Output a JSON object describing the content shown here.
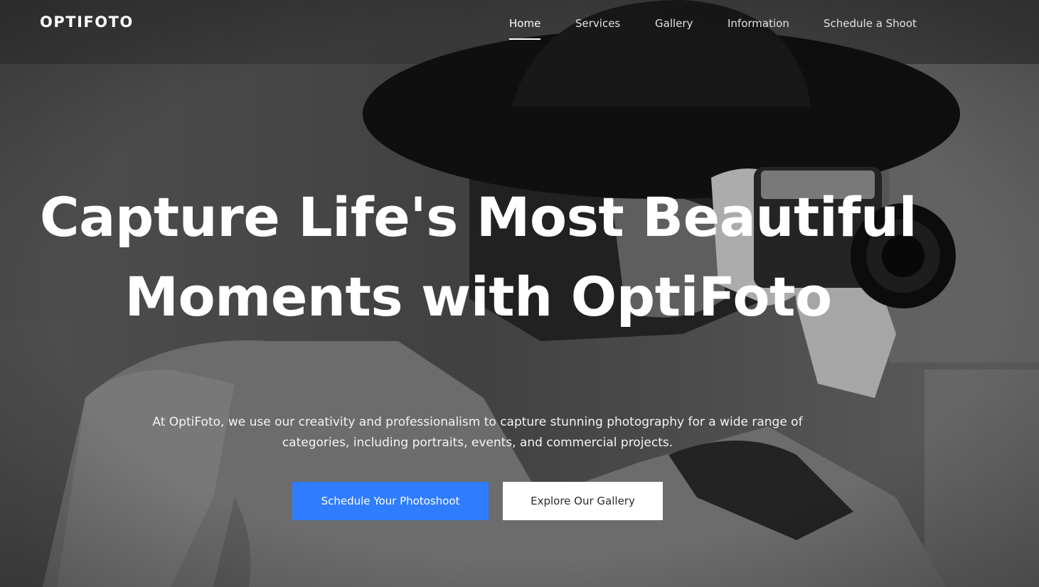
{
  "brand": {
    "logo_text": "OPTIFOTO"
  },
  "nav": {
    "items": [
      {
        "label": "Home",
        "active": true
      },
      {
        "label": "Services",
        "active": false
      },
      {
        "label": "Gallery",
        "active": false
      },
      {
        "label": "Information",
        "active": false
      },
      {
        "label": "Schedule a Shoot",
        "active": false
      }
    ]
  },
  "hero": {
    "headline": "Capture Life's Most Beautiful Moments with OptiFoto",
    "description": "At OptiFoto, we use our creativity and professionalism to capture stunning photography for a wide range of categories, including portraits, events, and commercial projects.",
    "primary_button": "Schedule Your Photoshoot",
    "secondary_button": "Explore Our Gallery",
    "background": "black-and-white photo of a woman in a wide-brim hat holding a camera"
  },
  "colors": {
    "primary_button_bg": "#2f7cff",
    "secondary_button_bg": "#ffffff",
    "text": "#ffffff"
  }
}
